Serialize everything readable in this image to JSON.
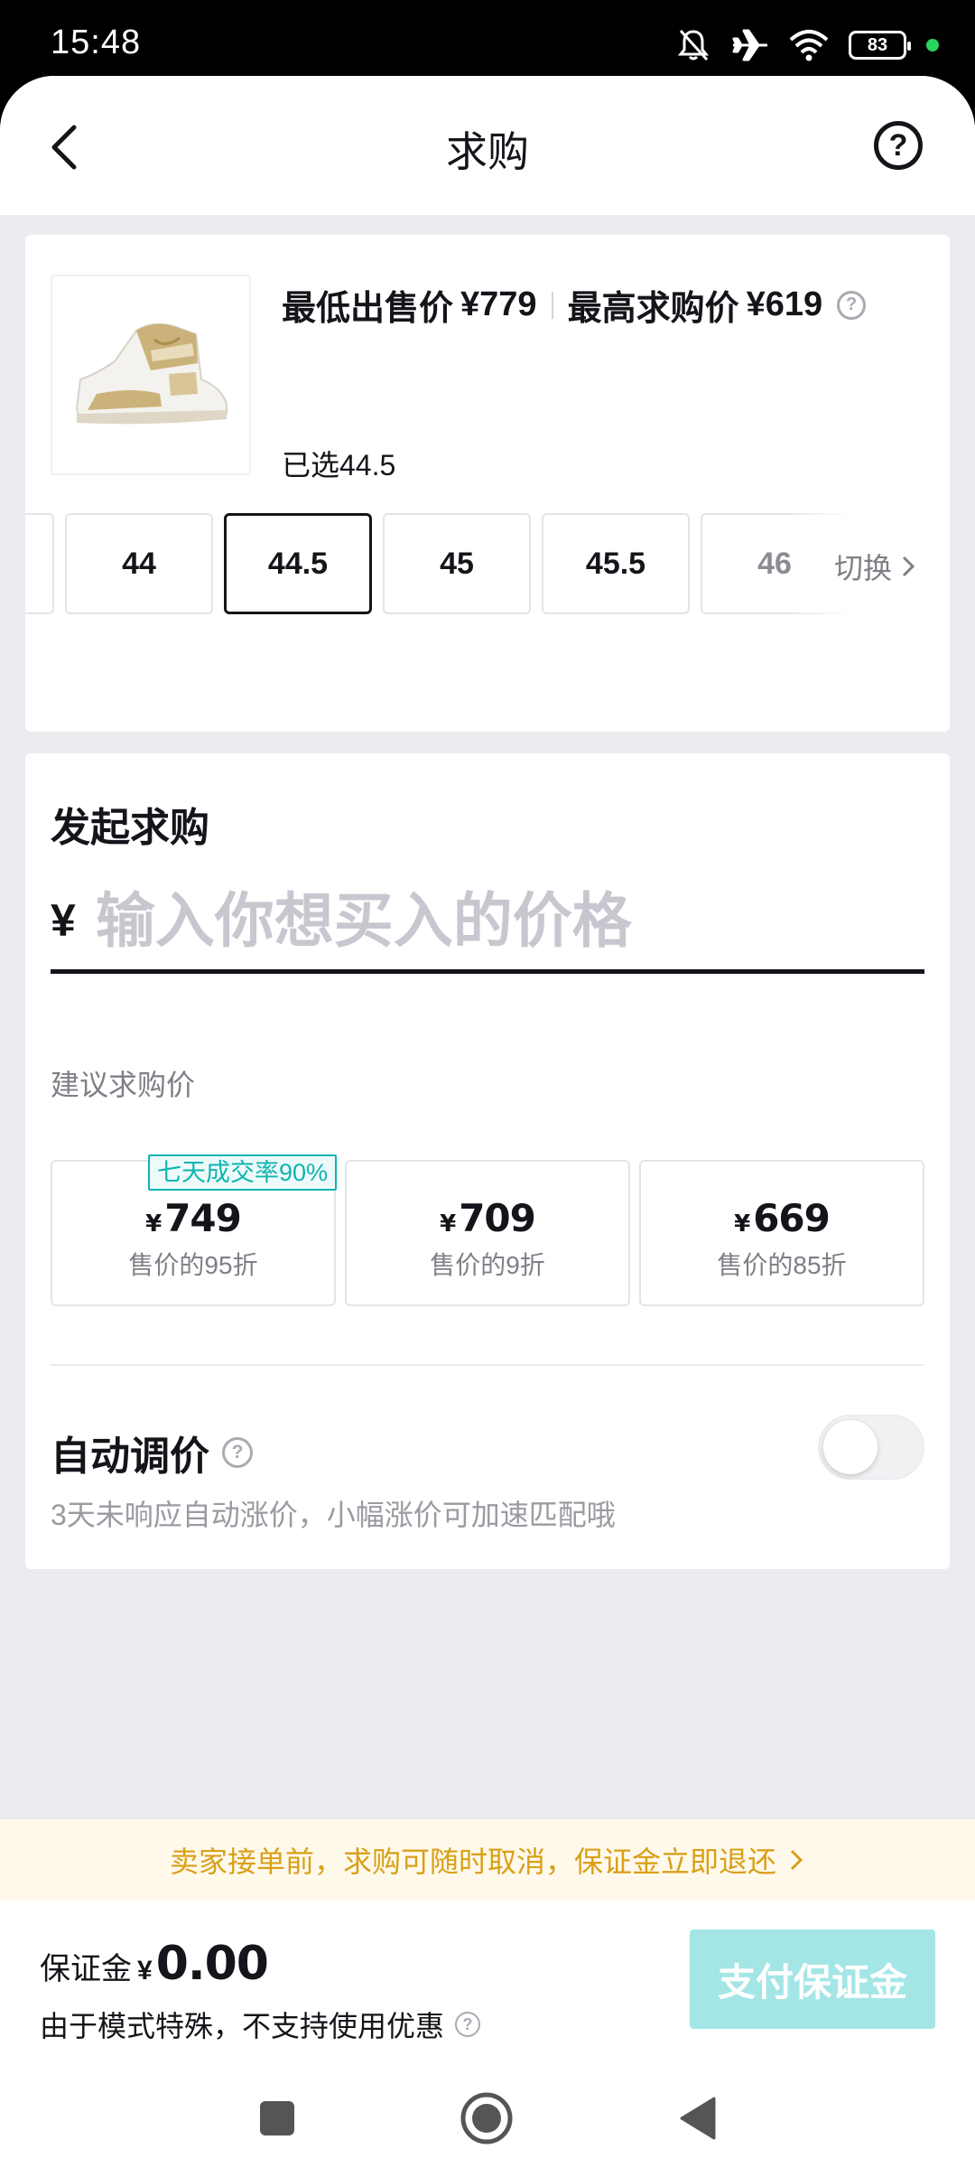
{
  "status_bar": {
    "time": "15:48",
    "battery": "83"
  },
  "nav": {
    "title": "求购",
    "help_glyph": "?"
  },
  "product": {
    "lowest_ask_label": "最低出售价",
    "lowest_ask_price": "¥779",
    "highest_bid_label": "最高求购价",
    "highest_bid_price": "¥619",
    "selected_text": "已选44.5",
    "sizes": [
      "44",
      "44.5",
      "45",
      "45.5",
      "46"
    ],
    "selected_size": "44.5",
    "switch_label": "切换"
  },
  "bid": {
    "title": "发起求购",
    "currency": "¥",
    "input_value": "",
    "input_placeholder": "输入你想买入的价格",
    "suggest_label": "建议求购价",
    "suggestions": [
      {
        "currency": "¥",
        "price": "749",
        "desc": "售价的95折",
        "tag": "七天成交率90%"
      },
      {
        "currency": "¥",
        "price": "709",
        "desc": "售价的9折"
      },
      {
        "currency": "¥",
        "price": "669",
        "desc": "售价的85折"
      }
    ],
    "auto_adjust_title": "自动调价",
    "auto_adjust_desc": "3天未响应自动涨价，小幅涨价可加速匹配哦",
    "auto_adjust_enabled": false
  },
  "notice": {
    "text": "卖家接单前，求购可随时取消，保证金立即退还"
  },
  "footer": {
    "deposit_label": "保证金",
    "currency": "¥",
    "deposit_amount": "0.00",
    "note": "由于模式特殊，不支持使用优惠",
    "pay_button": "支付保证金"
  },
  "colors": {
    "accent_teal": "#0fb5b0",
    "pay_button_disabled": "#a4e6e6",
    "notice_text": "#d9a017",
    "notice_bg": "#fff9ec",
    "page_bg": "#ebebf0"
  },
  "icons": [
    "mute-icon",
    "airplane-icon",
    "wifi-icon",
    "battery-icon",
    "back-icon",
    "help-icon",
    "chevron-right-icon",
    "square-icon",
    "home-circle-icon",
    "back-triangle-icon"
  ]
}
